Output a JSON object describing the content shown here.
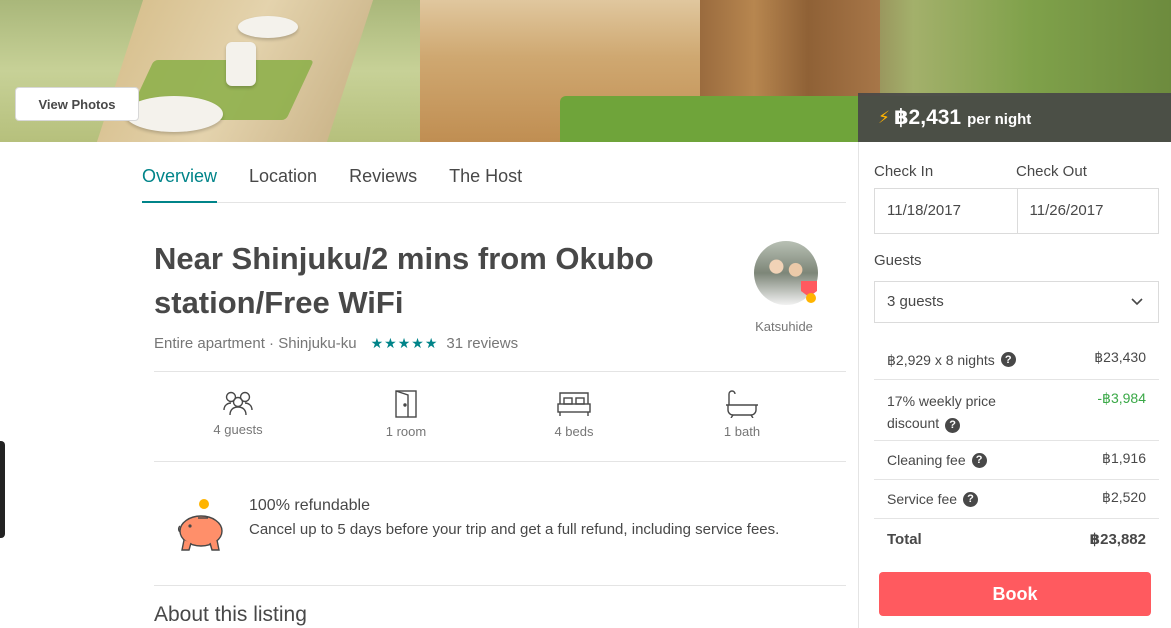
{
  "hero": {
    "view_photos_label": "View Photos"
  },
  "price_bar": {
    "icon": "lightning-icon",
    "amount": "฿2,431",
    "per": "per night"
  },
  "tabs": [
    {
      "label": "Overview",
      "active": true
    },
    {
      "label": "Location",
      "active": false
    },
    {
      "label": "Reviews",
      "active": false
    },
    {
      "label": "The Host",
      "active": false
    }
  ],
  "listing": {
    "title": "Near Shinjuku/2 mins from Okubo station/Free WiFi",
    "type_location": "Entire apartment · Shinjuku-ku",
    "stars": "★★★★★",
    "reviews": "31 reviews",
    "host_name": "Katsuhide",
    "amenities": [
      {
        "icon": "guests-icon",
        "label": "4 guests"
      },
      {
        "icon": "room-icon",
        "label": "1 room"
      },
      {
        "icon": "bed-icon",
        "label": "4 beds"
      },
      {
        "icon": "bath-icon",
        "label": "1 bath"
      }
    ],
    "refund": {
      "icon": "piggy-bank-icon",
      "title": "100% refundable",
      "body": "Cancel up to 5 days before your trip and get a full refund, including service fees."
    },
    "about_heading": "About this listing"
  },
  "booking": {
    "check_in_label": "Check In",
    "check_out_label": "Check Out",
    "check_in_value": "11/18/2017",
    "check_out_value": "11/26/2017",
    "guests_label": "Guests",
    "guests_value": "3 guests",
    "rows": [
      {
        "label": "฿2,929 x 8 nights",
        "value": "฿23,430"
      },
      {
        "label": "17% weekly price discount",
        "value": "-฿3,984"
      },
      {
        "label": "Cleaning fee",
        "value": "฿1,916"
      },
      {
        "label": "Service fee",
        "value": "฿2,520"
      },
      {
        "label": "Total",
        "value": "฿23,882"
      }
    ],
    "book_label": "Book",
    "colors": {
      "accent": "#008489",
      "book": "#ff5a5f",
      "discount": "#39a846",
      "lightning": "#ffb400"
    }
  }
}
